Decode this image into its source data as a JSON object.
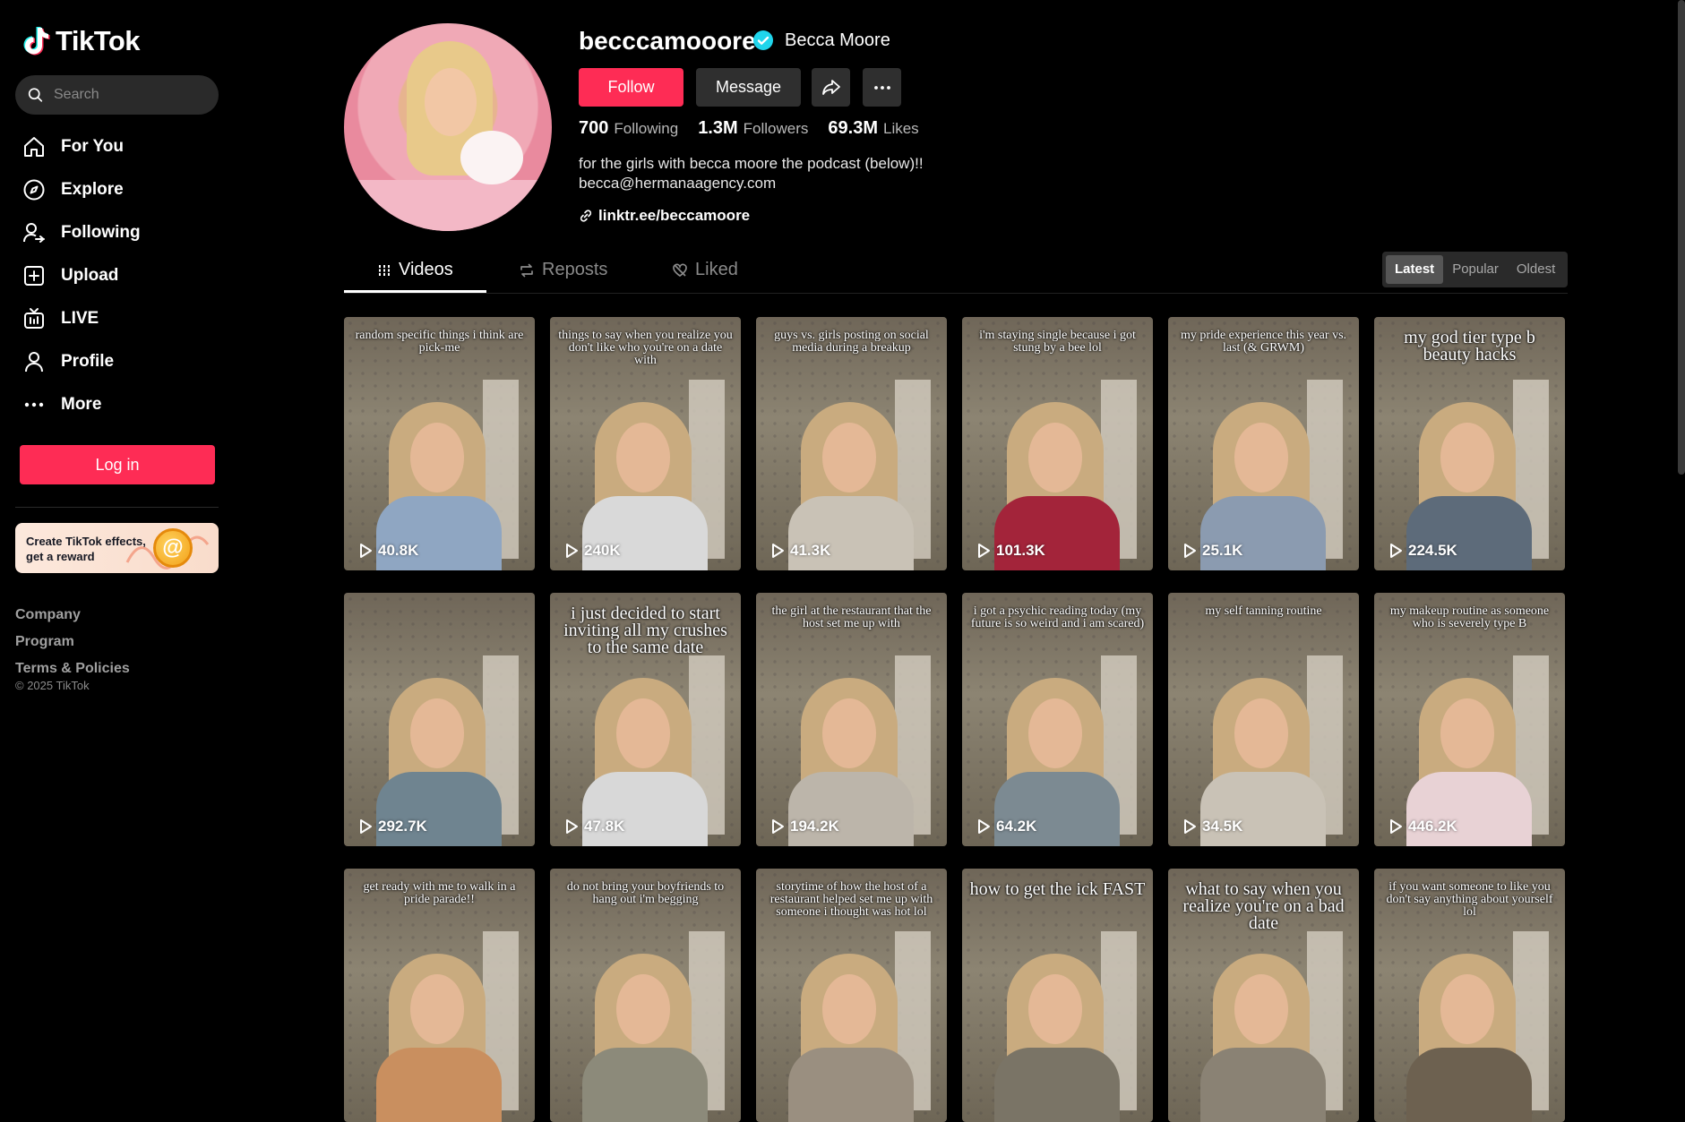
{
  "app": {
    "name": "TikTok"
  },
  "sidebar": {
    "search_placeholder": "Search",
    "items": [
      {
        "label": "For You",
        "icon": "home-icon"
      },
      {
        "label": "Explore",
        "icon": "compass-icon"
      },
      {
        "label": "Following",
        "icon": "following-icon"
      },
      {
        "label": "Upload",
        "icon": "upload-icon"
      },
      {
        "label": "LIVE",
        "icon": "live-icon"
      },
      {
        "label": "Profile",
        "icon": "profile-icon"
      },
      {
        "label": "More",
        "icon": "more-icon"
      }
    ],
    "login_label": "Log in",
    "effects_card": "Create TikTok effects, get a reward",
    "footer": [
      "Company",
      "Program",
      "Terms & Policies"
    ],
    "copyright": "© 2025 TikTok"
  },
  "profile": {
    "username": "becccamooore",
    "display_name": "Becca Moore",
    "follow_label": "Follow",
    "message_label": "Message",
    "stats": [
      {
        "value": "700",
        "label": "Following"
      },
      {
        "value": "1.3M",
        "label": "Followers"
      },
      {
        "value": "69.3M",
        "label": "Likes"
      }
    ],
    "bio_line1": "for the girls with becca moore the podcast (below)!!",
    "bio_line2": "becca@hermanaagency.com",
    "link": "linktr.ee/beccamoore"
  },
  "tabs": [
    {
      "label": "Videos",
      "icon": "grid-icon",
      "active": true
    },
    {
      "label": "Reposts",
      "icon": "repost-icon",
      "active": false
    },
    {
      "label": "Liked",
      "icon": "liked-icon",
      "active": false
    }
  ],
  "sort": [
    "Latest",
    "Popular",
    "Oldest"
  ],
  "videos": [
    {
      "caption": "random specific things i think are pick-me",
      "views": "40.8K"
    },
    {
      "caption": "things to say when you realize you don't like who you're on a date with",
      "views": "240K"
    },
    {
      "caption": "guys vs. girls posting on social media during a breakup",
      "views": "41.3K"
    },
    {
      "caption": "i'm staying single because i got stung by a bee lol",
      "views": "101.3K"
    },
    {
      "caption": "my pride experience this year vs. last (& GRWM)",
      "views": "25.1K"
    },
    {
      "caption": "my god tier type b beauty hacks",
      "views": "224.5K"
    },
    {
      "caption": "",
      "views": "292.7K"
    },
    {
      "caption": "i just decided to start inviting all my crushes to the same date",
      "views": "47.8K"
    },
    {
      "caption": "the girl at the restaurant that the host set me up with",
      "views": "194.2K"
    },
    {
      "caption": "i got a psychic reading today (my future is so weird and i am scared)",
      "views": "64.2K"
    },
    {
      "caption": "my self tanning routine",
      "views": "34.5K"
    },
    {
      "caption": "my makeup routine as someone who is severely type B",
      "views": "446.2K"
    },
    {
      "caption": "get ready with me to walk in a pride parade!!",
      "views": ""
    },
    {
      "caption": "do not bring your boyfriends to hang out i'm begging",
      "views": ""
    },
    {
      "caption": "storytime of how the host of a restaurant helped set me up with someone i thought was hot lol",
      "views": ""
    },
    {
      "caption": "how to get the ick FAST",
      "views": ""
    },
    {
      "caption": "what to say when you realize you're on a bad date",
      "views": ""
    },
    {
      "caption": "if you want someone to like you don't say anything about yourself lol",
      "views": ""
    }
  ],
  "colors": {
    "accent": "#fe2c55",
    "verified": "#20d5ec"
  }
}
